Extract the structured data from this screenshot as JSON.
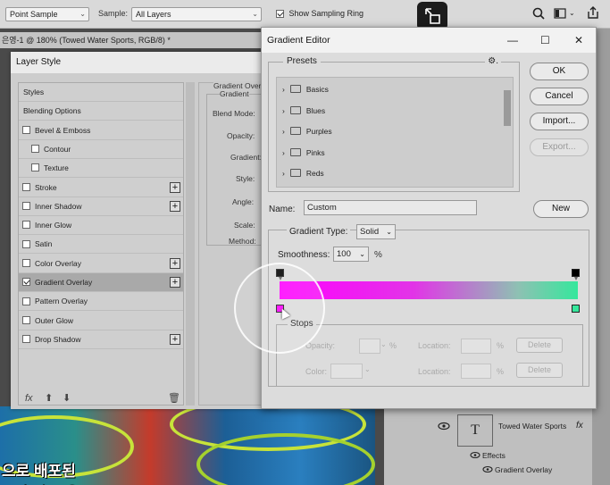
{
  "options_bar": {
    "sample_size": "Point Sample",
    "sample_label": "Sample:",
    "sample_value": "All Layers",
    "show_ring_label": "Show Sampling Ring",
    "show_ring_checked": true
  },
  "doc_tab": {
    "title": "은영-1 @ 180% (Towed Water Sports, RGB/8) *"
  },
  "layer_style": {
    "title": "Layer Style",
    "items": [
      {
        "label": "Styles",
        "checkbox": false,
        "plus": false
      },
      {
        "label": "Blending Options",
        "checkbox": false,
        "plus": false
      },
      {
        "label": "Bevel & Emboss",
        "checkbox": true,
        "checked": false,
        "plus": false
      },
      {
        "label": "Contour",
        "checkbox": true,
        "checked": false,
        "plus": false,
        "indent": true
      },
      {
        "label": "Texture",
        "checkbox": true,
        "checked": false,
        "plus": false,
        "indent": true
      },
      {
        "label": "Stroke",
        "checkbox": true,
        "checked": false,
        "plus": true
      },
      {
        "label": "Inner Shadow",
        "checkbox": true,
        "checked": false,
        "plus": true
      },
      {
        "label": "Inner Glow",
        "checkbox": true,
        "checked": false,
        "plus": false
      },
      {
        "label": "Satin",
        "checkbox": true,
        "checked": false,
        "plus": false
      },
      {
        "label": "Color Overlay",
        "checkbox": true,
        "checked": false,
        "plus": true
      },
      {
        "label": "Gradient Overlay",
        "checkbox": true,
        "checked": true,
        "plus": true,
        "selected": true
      },
      {
        "label": "Pattern Overlay",
        "checkbox": true,
        "checked": false,
        "plus": false
      },
      {
        "label": "Outer Glow",
        "checkbox": true,
        "checked": false,
        "plus": false
      },
      {
        "label": "Drop Shadow",
        "checkbox": true,
        "checked": false,
        "plus": true
      }
    ],
    "footer": {
      "fx": "fx",
      "up": "⬆",
      "down": "⬇",
      "trash": "🗑"
    },
    "right_panel": {
      "section": "Gradient Overl",
      "group": "Gradient",
      "labels": [
        "Blend Mode:",
        "Opacity:",
        "Gradient:",
        "Style:",
        "Angle:",
        "Scale:",
        "Method:"
      ]
    }
  },
  "gradient_editor": {
    "title": "Gradient Editor",
    "presets_label": "Presets",
    "gear": "⚙.",
    "presets": [
      "Basics",
      "Blues",
      "Purples",
      "Pinks",
      "Reds"
    ],
    "buttons": {
      "ok": "OK",
      "cancel": "Cancel",
      "import": "Import...",
      "export": "Export...",
      "new": "New"
    },
    "name_label": "Name:",
    "name_value": "Custom",
    "gradient_type_label": "Gradient Type:",
    "gradient_type_value": "Solid",
    "smoothness_label": "Smoothness:",
    "smoothness_value": "100",
    "smoothness_unit": "%",
    "colors": {
      "left": "#ff00ff",
      "right": "#35e79c"
    },
    "stops": {
      "title": "Stops",
      "opacity_label": "Opacity:",
      "opacity_unit": "%",
      "location_label": "Location:",
      "location_unit": "%",
      "color_label": "Color:",
      "delete_label": "Delete"
    }
  },
  "layers_panel": {
    "layer_name": "Towed Water Sports",
    "effects_label": "Effects",
    "effect_item": "Gradient Overlay",
    "fx": "fx"
  },
  "canvas": {
    "korean_text": "으로 배포된\n고과 각으 음"
  }
}
